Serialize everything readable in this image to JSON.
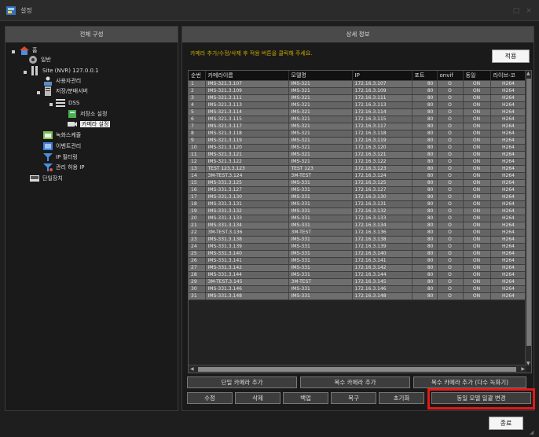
{
  "window": {
    "title": "설정",
    "minimize": "□",
    "close": "×"
  },
  "left_panel": {
    "header": "전체 구성",
    "tree": {
      "root": "홈",
      "general": "일반",
      "site": "Site (NVR) 127.0.0.1",
      "user_mgmt": "사용자관리",
      "storage_dist_server": "저장/분배서버",
      "dss": "DSS",
      "storage_settings": "저장소 설정",
      "camera_settings": "카메라 설정",
      "record_schedule": "녹화스케쥴",
      "event_mgmt": "이벤트관리",
      "ip_filtering": "IP 필터링",
      "admin_allow_ip": "관리 허용 IP",
      "single_device": "단일장치"
    }
  },
  "right_panel": {
    "header": "상세 정보",
    "hint": "카메라 추가/수정/삭제 후 적용 버튼을 클릭해 주세요.",
    "apply_label": "적용",
    "columns": [
      "순번",
      "카메라이름",
      "모델명",
      "IP",
      "포트",
      "onvif",
      "동일",
      "라이브-코"
    ],
    "rows": [
      [
        "1",
        "IMS-321.3.107",
        "IMS-321",
        "172.16.3.107",
        "80",
        "O",
        "ON",
        "H264"
      ],
      [
        "2",
        "IMS-321.3.109",
        "IMS-321",
        "172.16.3.109",
        "80",
        "O",
        "ON",
        "H264"
      ],
      [
        "3",
        "IMS-321.3.111",
        "IMS-321",
        "172.16.3.111",
        "80",
        "O",
        "ON",
        "H264"
      ],
      [
        "4",
        "IMS-321.3.113",
        "IMS-321",
        "172.16.3.113",
        "80",
        "O",
        "ON",
        "H264"
      ],
      [
        "5",
        "IMS-321.3.114",
        "IMS-321",
        "172.16.3.114",
        "80",
        "O",
        "ON",
        "H264"
      ],
      [
        "6",
        "IMS-321.3.115",
        "IMS-321",
        "172.16.3.115",
        "80",
        "O",
        "ON",
        "H264"
      ],
      [
        "7",
        "IMS-321.3.117",
        "IMS-321",
        "172.16.3.117",
        "80",
        "O",
        "ON",
        "H264"
      ],
      [
        "8",
        "IMS-321.3.118",
        "IMS-321",
        "172.16.3.118",
        "80",
        "O",
        "ON",
        "H264"
      ],
      [
        "9",
        "IMS-321.3.119",
        "IMS-321",
        "172.16.3.119",
        "80",
        "O",
        "ON",
        "H264"
      ],
      [
        "10",
        "IMS-321.3.120",
        "IMS-321",
        "172.16.3.120",
        "80",
        "O",
        "ON",
        "H264"
      ],
      [
        "11",
        "IMS-321.3.121",
        "IMS-321",
        "172.16.3.121",
        "80",
        "O",
        "ON",
        "H264"
      ],
      [
        "12",
        "IMS-321.3.122",
        "IMS-321",
        "172.16.3.122",
        "80",
        "O",
        "ON",
        "H264"
      ],
      [
        "13",
        "TEST 123.3.123",
        "TEST 123",
        "172.16.3.123",
        "80",
        "O",
        "ON",
        "H264"
      ],
      [
        "14",
        "3M-TEST.3.124",
        "3M-TEST",
        "172.16.3.124",
        "80",
        "O",
        "ON",
        "H264"
      ],
      [
        "15",
        "IMS-331.3.125",
        "IMS-331",
        "172.16.3.125",
        "80",
        "O",
        "ON",
        "H264"
      ],
      [
        "16",
        "IMS-331.3.127",
        "IMS-331",
        "172.16.3.127",
        "80",
        "O",
        "ON",
        "H264"
      ],
      [
        "17",
        "IMS-331.3.130",
        "IMS-331",
        "172.16.3.130",
        "80",
        "O",
        "ON",
        "H264"
      ],
      [
        "18",
        "IMS-331.3.131",
        "IMS-331",
        "172.16.3.131",
        "80",
        "O",
        "ON",
        "H264"
      ],
      [
        "19",
        "IMS-331.3.132",
        "IMS-331",
        "172.16.3.132",
        "80",
        "O",
        "ON",
        "H264"
      ],
      [
        "20",
        "IMS-331.3.133",
        "IMS-331",
        "172.16.3.133",
        "80",
        "O",
        "ON",
        "H264"
      ],
      [
        "21",
        "IMS-331.3.134",
        "IMS-331",
        "172.16.3.134",
        "80",
        "O",
        "ON",
        "H264"
      ],
      [
        "22",
        "3M-TEST.3.136",
        "3M-TEST",
        "172.16.3.136",
        "80",
        "O",
        "ON",
        "H264"
      ],
      [
        "23",
        "IMS-331.3.138",
        "IMS-331",
        "172.16.3.138",
        "80",
        "O",
        "ON",
        "H264"
      ],
      [
        "24",
        "IMS-331.3.139",
        "IMS-331",
        "172.16.3.139",
        "80",
        "O",
        "ON",
        "H264"
      ],
      [
        "25",
        "IMS-331.3.140",
        "IMS-331",
        "172.16.3.140",
        "80",
        "O",
        "ON",
        "H264"
      ],
      [
        "26",
        "IMS-331.3.141",
        "IMS-331",
        "172.16.3.141",
        "80",
        "O",
        "ON",
        "H264"
      ],
      [
        "27",
        "IMS-331.3.142",
        "IMS-331",
        "172.16.3.142",
        "80",
        "O",
        "ON",
        "H264"
      ],
      [
        "28",
        "IMS-331.3.144",
        "IMS-331",
        "172.16.3.144",
        "80",
        "O",
        "ON",
        "H264"
      ],
      [
        "29",
        "3M-TEST.3.145",
        "3M-TEST",
        "172.16.3.145",
        "80",
        "O",
        "ON",
        "H264"
      ],
      [
        "30",
        "IMS-331.3.146",
        "IMS-331",
        "172.16.3.146",
        "80",
        "O",
        "ON",
        "H264"
      ],
      [
        "31",
        "IMS-331.3.148",
        "IMS-331",
        "172.16.3.148",
        "80",
        "O",
        "ON",
        "H264"
      ]
    ],
    "buttons": {
      "add_single": "단일 카메라 추가",
      "add_multi": "복수 카메라 추가",
      "add_multi_record": "복수 카메라 추가 (다수 녹화기)",
      "edit": "수정",
      "delete": "삭제",
      "backup": "백업",
      "restore": "복구",
      "reset": "초기화",
      "bulk_model_change": "동일 모델 일괄 변경"
    }
  },
  "footer": {
    "close_label": "종료"
  },
  "colors": {
    "hint": "#c8a800",
    "highlight": "#e11a1a"
  }
}
